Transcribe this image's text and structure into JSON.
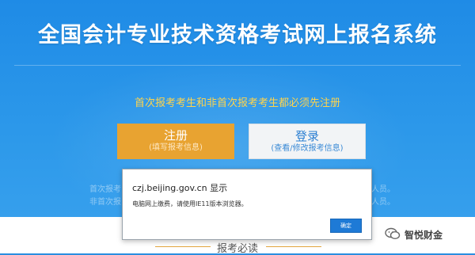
{
  "page": {
    "title": "全国会计专业技术资格考试网上报名系统",
    "notice": "首次报考考生和非首次报考考生都必须先注册"
  },
  "buttons": {
    "register": {
      "label": "注册",
      "sub": "(填写报考信息)"
    },
    "login": {
      "label": "登录",
      "sub": "(查看/修改报考信息)"
    }
  },
  "background_text": {
    "left_line1": "首次报考",
    "left_line2": "非首次报",
    "right_line1": "人员。",
    "right_line2": "人员。"
  },
  "footer": {
    "section_label": "报考必读",
    "watermark": "智悦财金"
  },
  "dialog": {
    "title": "czj.beijing.gov.cn 显示",
    "message": "电脑网上缴费，请使用IE11版本浏览器。",
    "ok_label": "确定"
  },
  "colors": {
    "accent_blue": "#1f8be6",
    "register_orange": "#e8a331",
    "notice_yellow": "#ffd44c",
    "dialog_button": "#1e7ad6"
  }
}
